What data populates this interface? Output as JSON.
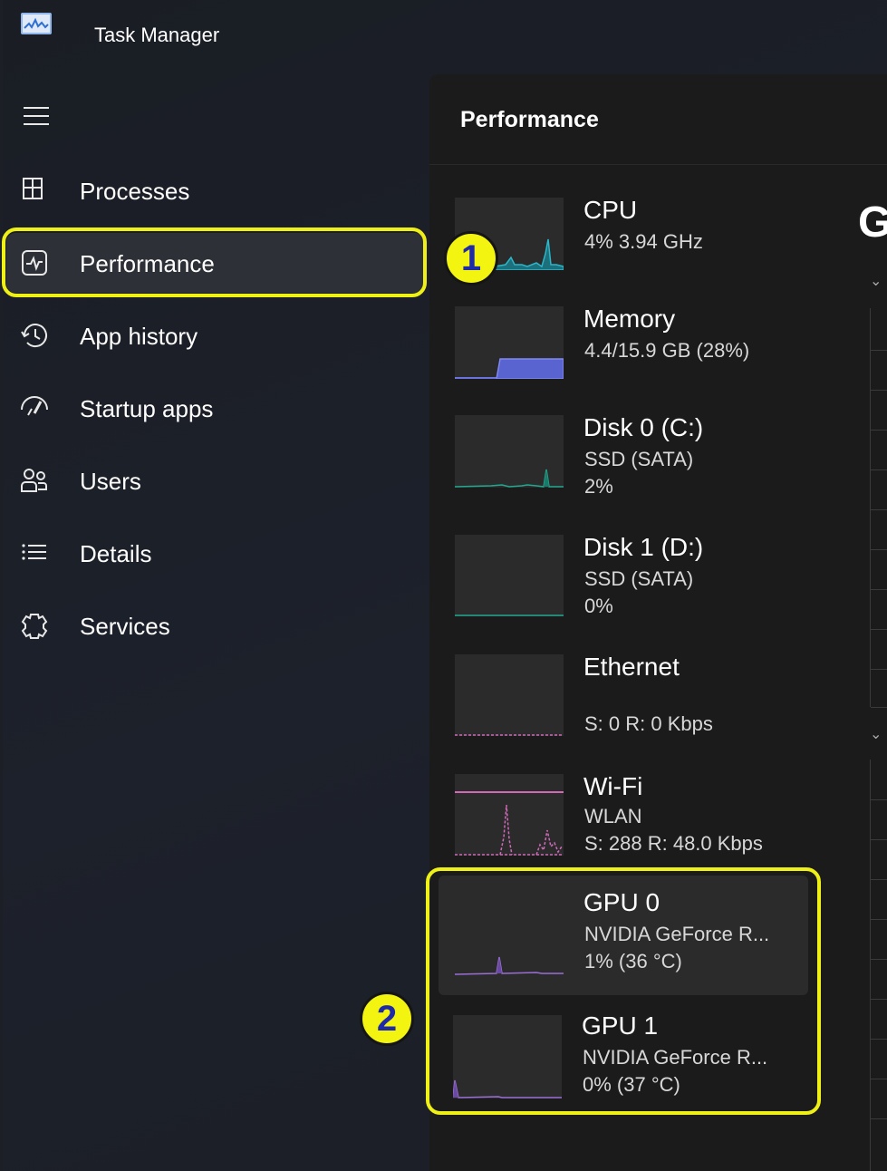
{
  "window": {
    "title": "Task Manager"
  },
  "sidebar": {
    "items": [
      {
        "label": "Processes",
        "icon": "processes-icon"
      },
      {
        "label": "Performance",
        "icon": "performance-icon",
        "active": true
      },
      {
        "label": "App history",
        "icon": "history-icon"
      },
      {
        "label": "Startup apps",
        "icon": "startup-icon"
      },
      {
        "label": "Users",
        "icon": "users-icon"
      },
      {
        "label": "Details",
        "icon": "details-icon"
      },
      {
        "label": "Services",
        "icon": "services-icon"
      }
    ]
  },
  "main": {
    "title": "Performance",
    "partial_heading": "G",
    "items": [
      {
        "name": "CPU",
        "lines": [
          "4%  3.94 GHz"
        ]
      },
      {
        "name": "Memory",
        "lines": [
          "4.4/15.9 GB (28%)"
        ]
      },
      {
        "name": "Disk 0 (C:)",
        "lines": [
          "SSD (SATA)",
          "2%"
        ]
      },
      {
        "name": "Disk 1 (D:)",
        "lines": [
          "SSD (SATA)",
          "0%"
        ]
      },
      {
        "name": "Ethernet",
        "lines": [
          "S: 0 R: 0 Kbps"
        ]
      },
      {
        "name": "Wi-Fi",
        "lines": [
          "WLAN",
          "S: 288  R: 48.0 Kbps"
        ]
      },
      {
        "name": "GPU 0",
        "lines": [
          "NVIDIA GeForce R...",
          "1%  (36 °C)"
        ],
        "selected": true
      },
      {
        "name": "GPU  1",
        "lines": [
          "NVIDIA GeForce R...",
          "0%  (37 °C)"
        ]
      }
    ]
  },
  "annotations": {
    "badge1": "1",
    "badge2": "2"
  },
  "colors": {
    "highlight": "#eef016",
    "cpu": "#2ab7c9",
    "memory": "#6a73e0",
    "disk": "#23a890",
    "network": "#d06ab8",
    "gpu": "#9a6fd4"
  }
}
